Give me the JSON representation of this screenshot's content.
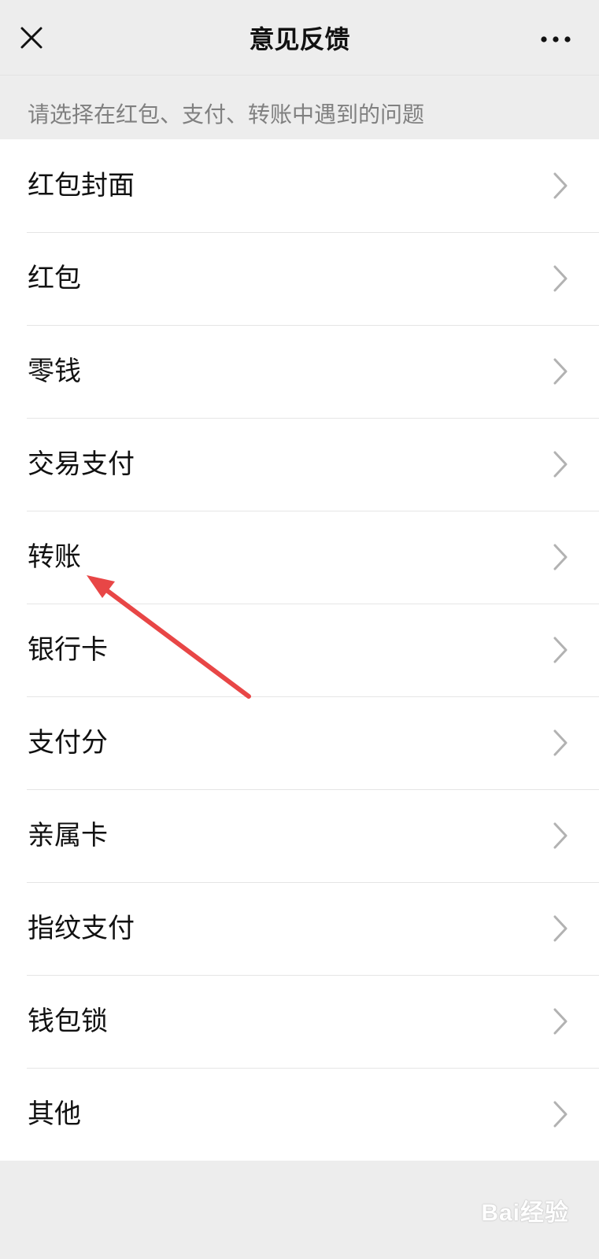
{
  "header": {
    "title": "意见反馈",
    "close_icon": "close-icon",
    "more_icon": "more-icon"
  },
  "subtitle": "请选择在红包、支付、转账中遇到的问题",
  "items": [
    {
      "label": "红包封面"
    },
    {
      "label": "红包"
    },
    {
      "label": "零钱"
    },
    {
      "label": "交易支付"
    },
    {
      "label": "转账"
    },
    {
      "label": "银行卡"
    },
    {
      "label": "支付分"
    },
    {
      "label": "亲属卡"
    },
    {
      "label": "指纹支付"
    },
    {
      "label": "钱包锁"
    },
    {
      "label": "其他"
    }
  ],
  "annotation": {
    "arrow_color": "#e84646",
    "points_to": "转账"
  },
  "watermark": {
    "text": "Bai经验"
  },
  "colors": {
    "background": "#ededed",
    "list_background": "#ffffff",
    "chevron": "#b2b2b2"
  }
}
